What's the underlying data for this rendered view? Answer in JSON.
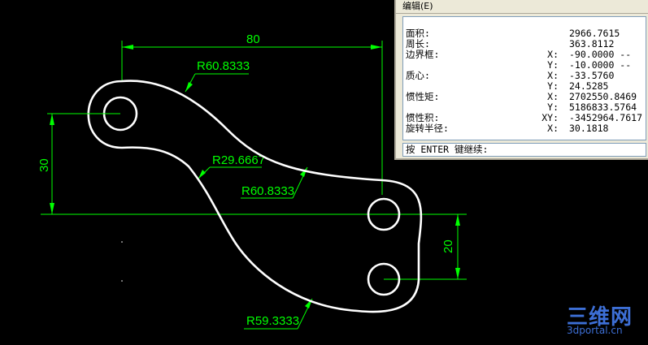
{
  "drawing": {
    "dim_width": "80",
    "dim_height_left": "30",
    "dim_height_right": "20",
    "radius_top_left": "R60.8333",
    "radius_inner": "R29.6667",
    "radius_mid": "R60.8333",
    "radius_bottom": "R59.3333",
    "line_color": "#00ff00",
    "profile_color": "#ffffff"
  },
  "text_window": {
    "menu": "编辑(E)",
    "rows": [
      {
        "label": "面积:",
        "axis": "",
        "value": "2966.7615"
      },
      {
        "label": "周长:",
        "axis": "",
        "value": "363.8112"
      },
      {
        "label": "边界框:",
        "axis": "X:",
        "value": "-90.0000  --"
      },
      {
        "label": "",
        "axis": "Y:",
        "value": "-10.0000  --"
      },
      {
        "label": "质心:",
        "axis": "X:",
        "value": "-33.5760"
      },
      {
        "label": "",
        "axis": "Y:",
        "value": "24.5285"
      },
      {
        "label": "惯性矩:",
        "axis": "X:",
        "value": "2702550.8469"
      },
      {
        "label": "",
        "axis": "Y:",
        "value": "5186833.5764"
      },
      {
        "label": "惯性积:",
        "axis": "XY:",
        "value": "-3452964.7617"
      },
      {
        "label": "旋转半径:",
        "axis": "X:",
        "value": "30.1818"
      }
    ],
    "command_prompt": "按 ENTER 键继续:"
  },
  "watermark": {
    "logo": "三维网",
    "site": "3dportal.cn"
  }
}
